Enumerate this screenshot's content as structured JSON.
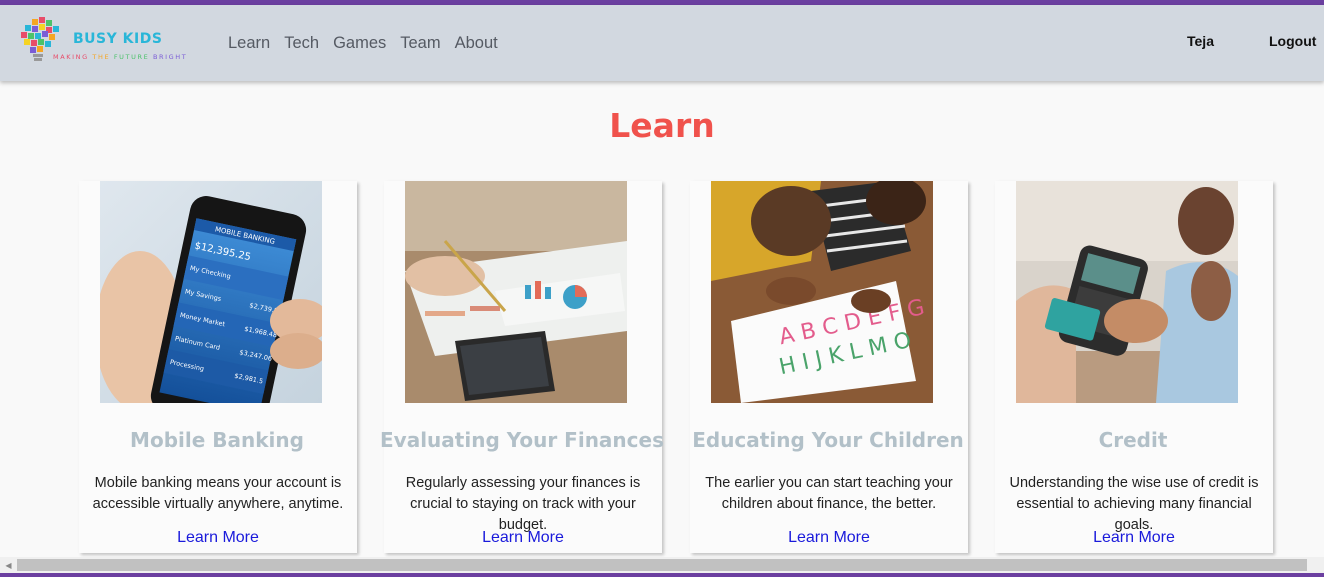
{
  "brand": {
    "name": "BUSY KIDS",
    "tagline_parts": [
      "MAKING",
      " THE ",
      "FUTURE",
      " BRIGHT"
    ],
    "tagline_colors": [
      "#e84c6a",
      "#f5a623",
      "#4cc26b",
      "#7b5cd6"
    ]
  },
  "nav": {
    "links": [
      "Learn",
      "Tech",
      "Games",
      "Team",
      "About"
    ],
    "user": "Teja",
    "logout": "Logout"
  },
  "page": {
    "title": "Learn"
  },
  "cards": [
    {
      "title": "Mobile Banking",
      "description": "Mobile banking means your account is accessible virtually anywhere, anytime.",
      "link": "Learn More"
    },
    {
      "title": "Evaluating Your Finances",
      "description": "Regularly assessing your finances is crucial to staying on track with your budget.",
      "link": "Learn More"
    },
    {
      "title": "Educating Your Children",
      "description": "The earlier you can start teaching your children about finance, the better.",
      "link": "Learn More"
    },
    {
      "title": "Credit",
      "description": "Understanding the wise use of credit is essential to achieving many financial goals.",
      "link": "Learn More"
    }
  ],
  "phone_screen": {
    "header": "MOBILE BANKING",
    "balance": "$12,395.25",
    "rows": [
      {
        "label": "My Checking",
        "amount": ""
      },
      {
        "label": "My Savings",
        "amount": "$2,739.84"
      },
      {
        "label": "Money Market",
        "amount": "$1,968.48"
      },
      {
        "label": "Platinum Card",
        "amount": "$3,247.06"
      },
      {
        "label": "Processing",
        "amount": "$2,981.5"
      }
    ]
  },
  "colors": {
    "accent_title": "#f0524c",
    "card_title": "#b2c0c8",
    "link": "#1a1adb",
    "navbar": "#d2d8e0",
    "stripe": "#6b3fa0"
  }
}
